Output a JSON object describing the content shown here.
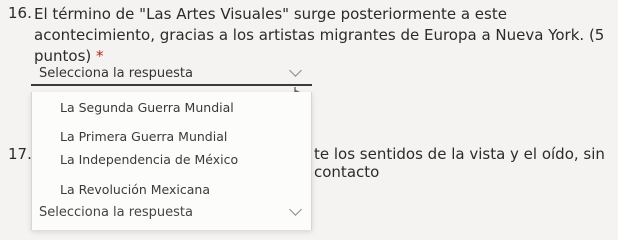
{
  "question16": {
    "number": "16.",
    "text": "El término de \"Las Artes Visuales\" surge posteriormente a este acontecimiento, gracias a los artistas migrantes de Europa a Nueva York. (5 puntos)",
    "required_marker": "*"
  },
  "select16": {
    "placeholder": "Selecciona la respuesta",
    "options": [
      "La Segunda Guerra Mundial",
      "La Primera Guerra Mundial",
      "La Independencia de México",
      "La Revolución Mexicana"
    ]
  },
  "question17": {
    "number": "17.",
    "text_visible": "te los sentidos de la vista y el oído, sin contacto"
  },
  "select17": {
    "placeholder": "Selecciona la respuesta"
  },
  "icons": {
    "dropdown_chevron": "chevron-down-icon",
    "pointer": "hand-pointer-icon"
  },
  "colors": {
    "background": "#f4f3f1",
    "required_star": "#b3261e",
    "underline": "#3a3a3a"
  }
}
